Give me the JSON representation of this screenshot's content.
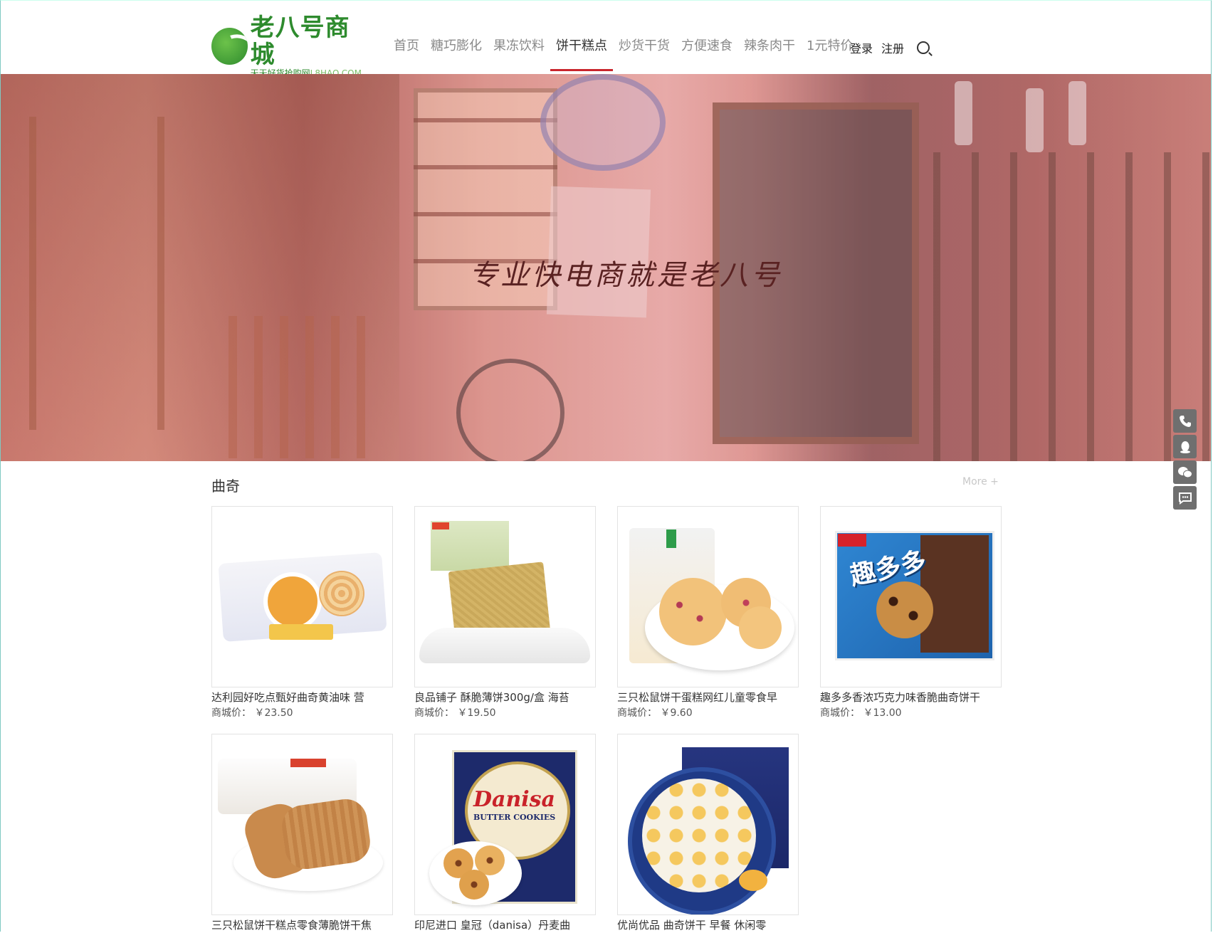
{
  "header": {
    "logo_title": "老八号商城",
    "logo_slogan": "天天好货抢购网",
    "logo_url": "L8HAO.COM",
    "nav": [
      {
        "label": "首页",
        "active": false
      },
      {
        "label": "糖巧膨化",
        "active": false
      },
      {
        "label": "果冻饮料",
        "active": false
      },
      {
        "label": "饼干糕点",
        "active": true
      },
      {
        "label": "炒货干货",
        "active": false
      },
      {
        "label": "方便速食",
        "active": false
      },
      {
        "label": "辣条肉干",
        "active": false
      },
      {
        "label": "1元特价",
        "active": false
      }
    ],
    "login_label": "登录",
    "register_label": "注册"
  },
  "banner": {
    "headline": "专业快电商就是老八号"
  },
  "section": {
    "title": "曲奇",
    "more_label": "More +",
    "price_label": "商城价：",
    "products": [
      {
        "name": "达利园好吃点甄好曲奇黄油味 营",
        "price": "￥23.50"
      },
      {
        "name": "良品铺子 酥脆薄饼300g/盒 海苔",
        "price": "￥19.50"
      },
      {
        "name": "三只松鼠饼干蛋糕网红儿童零食早",
        "price": "￥9.60"
      },
      {
        "name": "趣多多香浓巧克力味香脆曲奇饼干",
        "price": "￥13.00"
      },
      {
        "name": "三只松鼠饼干糕点零食薄脆饼干焦",
        "price": ""
      },
      {
        "name": "印尼进口 皇冠（danisa）丹麦曲",
        "price": ""
      },
      {
        "name": "优尚优品 曲奇饼干 早餐 休闲零",
        "price": ""
      }
    ]
  },
  "colors": {
    "brand_green": "#2e8b2e",
    "active_underline": "#c9252c",
    "side_button": "#6f6f6f"
  },
  "icons": [
    "phone-icon",
    "qq-icon",
    "wechat-icon",
    "chat-icon",
    "search-icon"
  ]
}
